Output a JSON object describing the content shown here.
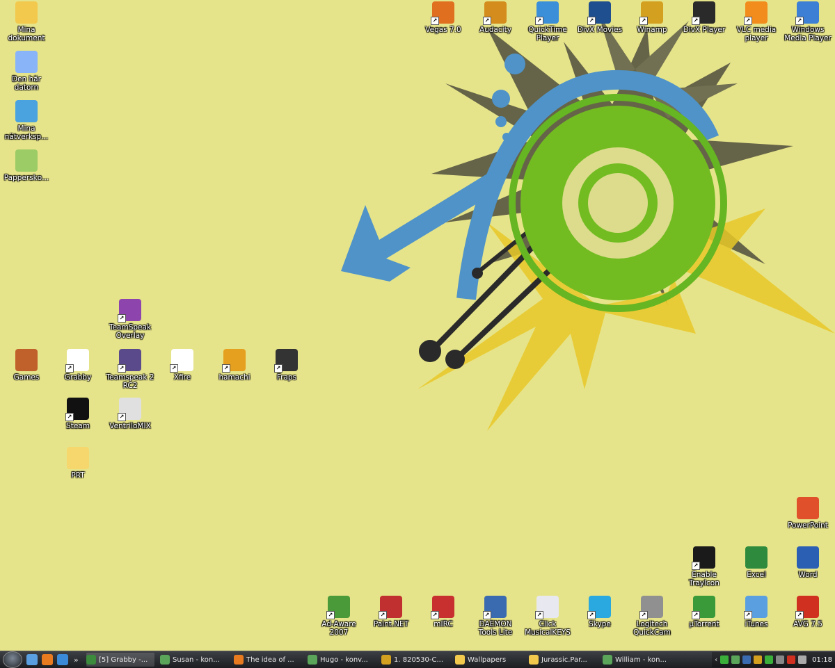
{
  "desktop": {
    "icons": [
      {
        "id": "mina-dokument",
        "label": "Mina dokument",
        "color": "#f2c94c",
        "shortcut": false
      },
      {
        "id": "den-har-datorn",
        "label": "Den här datorn",
        "color": "#8ab4f8",
        "shortcut": false
      },
      {
        "id": "mina-natverksplatser",
        "label": "Mina nätverksp...",
        "color": "#4aa3df",
        "shortcut": false
      },
      {
        "id": "papperskorgen",
        "label": "Papperskо...",
        "color": "#9ccc65",
        "shortcut": false
      },
      {
        "id": "teamspeak-overlay",
        "label": "TeamSpeak Overlay",
        "color": "#8e44ad",
        "shortcut": true
      },
      {
        "id": "games",
        "label": "Games",
        "color": "#c0612b",
        "shortcut": false
      },
      {
        "id": "grabby",
        "label": "Grabby",
        "color": "#ffffff",
        "shortcut": true
      },
      {
        "id": "teamspeak-2",
        "label": "Teamspeak 2 RC2",
        "color": "#5b4a8b",
        "shortcut": true
      },
      {
        "id": "xfire",
        "label": "Xfire",
        "color": "#ffffff",
        "shortcut": true
      },
      {
        "id": "hamachi",
        "label": "hamachi",
        "color": "#e6a020",
        "shortcut": true
      },
      {
        "id": "fraps",
        "label": "Fraps",
        "color": "#333333",
        "shortcut": true
      },
      {
        "id": "steam",
        "label": "Steam",
        "color": "#111111",
        "shortcut": true
      },
      {
        "id": "ventrilomix",
        "label": "VentriloMIX",
        "color": "#e0e0e0",
        "shortcut": true
      },
      {
        "id": "prt",
        "label": "PRT",
        "color": "#f5d76e",
        "shortcut": false
      },
      {
        "id": "vegas",
        "label": "Vegas 7.0",
        "color": "#e07020",
        "shortcut": true
      },
      {
        "id": "audacity",
        "label": "Audacity",
        "color": "#d48c1c",
        "shortcut": true
      },
      {
        "id": "quicktime",
        "label": "QuickTime Player",
        "color": "#3b8fd9",
        "shortcut": true
      },
      {
        "id": "divx-movies",
        "label": "DivX Movies",
        "color": "#1f4f8f",
        "shortcut": true
      },
      {
        "id": "winamp",
        "label": "Winamp",
        "color": "#d4a020",
        "shortcut": true
      },
      {
        "id": "divx-player",
        "label": "DivX Player",
        "color": "#2a2a2a",
        "shortcut": true
      },
      {
        "id": "vlc",
        "label": "VLC media player",
        "color": "#f28c1c",
        "shortcut": true
      },
      {
        "id": "wmp",
        "label": "Windows Media Player",
        "color": "#3c7fd4",
        "shortcut": true
      },
      {
        "id": "powerpoint",
        "label": "PowerPoint",
        "color": "#e0502b",
        "shortcut": false
      },
      {
        "id": "enable-traycon",
        "label": "Enable TrayIcon",
        "color": "#1a1a1a",
        "shortcut": true
      },
      {
        "id": "excel",
        "label": "Excel",
        "color": "#2e8b3e",
        "shortcut": false
      },
      {
        "id": "word",
        "label": "Word",
        "color": "#2b5fb4",
        "shortcut": false
      },
      {
        "id": "ad-aware",
        "label": "Ad-Aware 2007",
        "color": "#4a9a3a",
        "shortcut": true
      },
      {
        "id": "paint-net",
        "label": "Paint.NET",
        "color": "#c03030",
        "shortcut": true
      },
      {
        "id": "mirc",
        "label": "mIRC",
        "color": "#c83030",
        "shortcut": true
      },
      {
        "id": "daemon-tools",
        "label": "DAEMON Tools Lite",
        "color": "#3a6ab0",
        "shortcut": true
      },
      {
        "id": "click-musicalkeys",
        "label": "Click MusicalKEYS",
        "color": "#e8e8f0",
        "shortcut": true
      },
      {
        "id": "skype",
        "label": "Skype",
        "color": "#2aa9e0",
        "shortcut": true
      },
      {
        "id": "logitech-quickcam",
        "label": "Logitech QuickCam",
        "color": "#909090",
        "shortcut": true
      },
      {
        "id": "utorrent",
        "label": "µTorrent",
        "color": "#3a9a3a",
        "shortcut": true
      },
      {
        "id": "itunes",
        "label": "iTunes",
        "color": "#5aa0e0",
        "shortcut": true
      },
      {
        "id": "avg",
        "label": "AVG 7.5",
        "color": "#d03020",
        "shortcut": true
      }
    ]
  },
  "taskbar": {
    "quick_launch": [
      {
        "id": "show-desktop",
        "color": "#5aa0e0"
      },
      {
        "id": "firefox",
        "color": "#e87a20"
      },
      {
        "id": "ie",
        "color": "#3a8ad8"
      }
    ],
    "more_label": "»",
    "tasks": [
      {
        "label": "[5] Grabby -...",
        "color": "#3c8a3c",
        "active": true
      },
      {
        "label": "Susan - kon...",
        "color": "#5aa55a",
        "active": false
      },
      {
        "label": "The idea of ...",
        "color": "#e87a20",
        "active": false
      },
      {
        "label": "Hugo - konv...",
        "color": "#5aa55a",
        "active": false
      },
      {
        "label": "1. 820530-C...",
        "color": "#d4a020",
        "active": false
      },
      {
        "label": "Wallpapers",
        "color": "#f2c94c",
        "active": false
      },
      {
        "label": "Jurassic.Par...",
        "color": "#f2c94c",
        "active": false
      },
      {
        "label": "William - kon...",
        "color": "#5aa55a",
        "active": false
      }
    ],
    "tray": {
      "chevron": "‹",
      "icons": [
        "#3ab03a",
        "#5aa55a",
        "#3a6ab0",
        "#d4a020",
        "#3ab03a",
        "#888888",
        "#d03020",
        "#aaaaaa"
      ],
      "clock": "01:18"
    }
  }
}
